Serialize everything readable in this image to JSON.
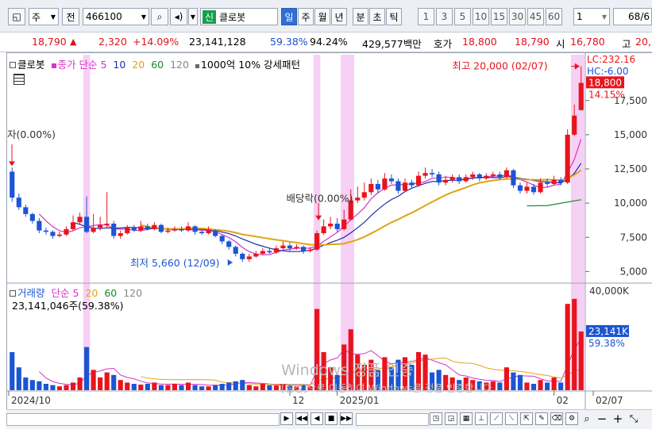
{
  "toolbar": {
    "type_label": "주",
    "jeon_label": "전",
    "code": "466100",
    "sin_badge": "신",
    "stock_name": "클로봇",
    "periods": [
      "일",
      "주",
      "월",
      "년",
      "분",
      "초",
      "틱"
    ],
    "selected_period": "일",
    "intervals": [
      "1",
      "3",
      "5",
      "10",
      "15",
      "30",
      "45",
      "60"
    ],
    "count_value": "1",
    "page_value": "68/6"
  },
  "quote": {
    "price": "18,790",
    "arrow": "▲",
    "change": "2,320",
    "change_pct": "+14.09%",
    "volume": "23,141,128",
    "turnover_pct": "59.38%",
    "strength_pct": "94.24%",
    "amount": "429,577백만",
    "ask_label": "호가",
    "ask_price": "18,800",
    "bid_price": "18,790",
    "open_label": "시",
    "open_price": "16,780",
    "high_label": "고",
    "high_price": "20,"
  },
  "price_legend": {
    "name": "클로봇",
    "ma_label": "종가 단순",
    "ma_periods": [
      "5",
      "10",
      "20",
      "60",
      "120"
    ],
    "pattern": "1000억 10% 강세패턴"
  },
  "volume_legend": {
    "name": "거래량",
    "ma_label": "단순",
    "ma_periods": [
      "5",
      "20",
      "60",
      "120"
    ],
    "volume_text": "23,141,046주(59.38%)"
  },
  "annotations": {
    "high": "최고 20,000 (02/07)",
    "low": "최저 5,660 (12/09)",
    "dividend": "배당락(0.00%)",
    "left_marker": "자(0.00%)"
  },
  "right_axis": {
    "lc": "LC:232.16",
    "hc": "HC:-6.00",
    "current_price": "18,800",
    "current_pct": "14.15%",
    "price_ticks": [
      "17,500",
      "15,000",
      "12,500",
      "10,000",
      "7,500",
      "5,000"
    ],
    "volume_top": "40,000K",
    "volume_current": "23,141K",
    "volume_pct": "59.38%"
  },
  "x_labels": [
    "2024/10",
    "12",
    "2025/01",
    "02",
    "02/07"
  ],
  "watermark": {
    "line1": "Windows 정품 인증",
    "line2": "[설정]으로 이동하여 Windows를 정품 인증합니다."
  },
  "colors": {
    "up": "#e8141d",
    "down": "#1c55d4",
    "ma5": "#d633c8",
    "ma10": "#1a2fa8",
    "ma20": "#e0a418",
    "ma60": "#138a2c",
    "highlight": "#f6c8f3"
  },
  "chart_data": {
    "type": "candlestick",
    "ylim": [
      4500,
      20500
    ],
    "volume_ylim": [
      0,
      40000000
    ],
    "candles": [
      {
        "o": 12300,
        "c": 10400,
        "h": 12600,
        "l": 10100,
        "v": 15000000
      },
      {
        "o": 10400,
        "c": 9700,
        "h": 10700,
        "l": 9500,
        "v": 9000000
      },
      {
        "o": 9700,
        "c": 9200,
        "h": 9900,
        "l": 9000,
        "v": 5000000
      },
      {
        "o": 9200,
        "c": 8700,
        "h": 9300,
        "l": 8500,
        "v": 4000000
      },
      {
        "o": 8700,
        "c": 8000,
        "h": 8900,
        "l": 7800,
        "v": 3500000
      },
      {
        "o": 8000,
        "c": 7900,
        "h": 8200,
        "l": 7700,
        "v": 2500000
      },
      {
        "o": 7900,
        "c": 7600,
        "h": 8000,
        "l": 7400,
        "v": 2000000
      },
      {
        "o": 7600,
        "c": 7700,
        "h": 7900,
        "l": 7500,
        "v": 1500000
      },
      {
        "o": 7700,
        "c": 8100,
        "h": 8300,
        "l": 7600,
        "v": 2000000
      },
      {
        "o": 8100,
        "c": 8600,
        "h": 9100,
        "l": 8000,
        "v": 3000000
      },
      {
        "o": 8600,
        "c": 9000,
        "h": 9300,
        "l": 8400,
        "v": 5000000
      },
      {
        "o": 9000,
        "c": 7900,
        "h": 10500,
        "l": 7800,
        "v": 17000000
      },
      {
        "o": 7900,
        "c": 8200,
        "h": 9200,
        "l": 7800,
        "v": 8000000
      },
      {
        "o": 8200,
        "c": 8400,
        "h": 9000,
        "l": 8000,
        "v": 5000000
      },
      {
        "o": 8400,
        "c": 8500,
        "h": 10800,
        "l": 8200,
        "v": 7000000
      },
      {
        "o": 8500,
        "c": 7600,
        "h": 8700,
        "l": 7400,
        "v": 6000000
      },
      {
        "o": 7600,
        "c": 7800,
        "h": 8000,
        "l": 7400,
        "v": 4000000
      },
      {
        "o": 7800,
        "c": 8200,
        "h": 8400,
        "l": 7700,
        "v": 3000000
      },
      {
        "o": 8200,
        "c": 8000,
        "h": 8400,
        "l": 7900,
        "v": 2500000
      },
      {
        "o": 8000,
        "c": 8300,
        "h": 8700,
        "l": 7900,
        "v": 2200000
      },
      {
        "o": 8300,
        "c": 8100,
        "h": 8500,
        "l": 8000,
        "v": 2500000
      },
      {
        "o": 8100,
        "c": 8400,
        "h": 8600,
        "l": 8000,
        "v": 3000000
      },
      {
        "o": 8400,
        "c": 7900,
        "h": 8500,
        "l": 7800,
        "v": 2000000
      },
      {
        "o": 7900,
        "c": 8000,
        "h": 8200,
        "l": 7800,
        "v": 2000000
      },
      {
        "o": 8000,
        "c": 8100,
        "h": 8300,
        "l": 7900,
        "v": 2500000
      },
      {
        "o": 8100,
        "c": 8000,
        "h": 8300,
        "l": 7900,
        "v": 2000000
      },
      {
        "o": 8000,
        "c": 8300,
        "h": 8600,
        "l": 7900,
        "v": 3000000
      },
      {
        "o": 8300,
        "c": 7900,
        "h": 8400,
        "l": 7700,
        "v": 2000000
      },
      {
        "o": 7900,
        "c": 7800,
        "h": 8100,
        "l": 7700,
        "v": 1500000
      },
      {
        "o": 7800,
        "c": 8000,
        "h": 8300,
        "l": 7700,
        "v": 1500000
      },
      {
        "o": 8000,
        "c": 7600,
        "h": 8100,
        "l": 7500,
        "v": 2000000
      },
      {
        "o": 7600,
        "c": 7200,
        "h": 7700,
        "l": 7000,
        "v": 2500000
      },
      {
        "o": 7200,
        "c": 6800,
        "h": 7300,
        "l": 6600,
        "v": 3000000
      },
      {
        "o": 6800,
        "c": 6300,
        "h": 6900,
        "l": 6100,
        "v": 3500000
      },
      {
        "o": 6300,
        "c": 5900,
        "h": 6400,
        "l": 5700,
        "v": 4000000
      },
      {
        "o": 5900,
        "c": 6100,
        "h": 6300,
        "l": 5700,
        "v": 2000000
      },
      {
        "o": 6100,
        "c": 6300,
        "h": 6500,
        "l": 6000,
        "v": 1500000
      },
      {
        "o": 6300,
        "c": 6500,
        "h": 6700,
        "l": 6200,
        "v": 2500000
      },
      {
        "o": 6500,
        "c": 6400,
        "h": 6700,
        "l": 6300,
        "v": 2000000
      },
      {
        "o": 6400,
        "c": 6700,
        "h": 6900,
        "l": 6300,
        "v": 1800000
      },
      {
        "o": 6700,
        "c": 6900,
        "h": 7200,
        "l": 6600,
        "v": 2500000
      },
      {
        "o": 6900,
        "c": 6700,
        "h": 7100,
        "l": 6500,
        "v": 2000000
      },
      {
        "o": 6700,
        "c": 6800,
        "h": 7000,
        "l": 6600,
        "v": 1500000
      },
      {
        "o": 6800,
        "c": 6500,
        "h": 6900,
        "l": 6300,
        "v": 2000000
      },
      {
        "o": 6500,
        "c": 6600,
        "h": 6800,
        "l": 6400,
        "v": 1500000
      },
      {
        "o": 6600,
        "c": 7800,
        "h": 8000,
        "l": 6500,
        "v": 32000000
      },
      {
        "o": 7800,
        "c": 8300,
        "h": 8800,
        "l": 7700,
        "v": 15000000
      },
      {
        "o": 8300,
        "c": 8500,
        "h": 9000,
        "l": 8100,
        "v": 9000000
      },
      {
        "o": 8500,
        "c": 8100,
        "h": 8900,
        "l": 7900,
        "v": 6000000
      },
      {
        "o": 8100,
        "c": 8800,
        "h": 9500,
        "l": 8000,
        "v": 18000000
      },
      {
        "o": 8800,
        "c": 10200,
        "h": 11000,
        "l": 8700,
        "v": 24000000
      },
      {
        "o": 10200,
        "c": 10400,
        "h": 11200,
        "l": 10000,
        "v": 14000000
      },
      {
        "o": 10400,
        "c": 10800,
        "h": 11500,
        "l": 10200,
        "v": 10000000
      },
      {
        "o": 10800,
        "c": 11400,
        "h": 11800,
        "l": 10600,
        "v": 12000000
      },
      {
        "o": 11400,
        "c": 11000,
        "h": 11700,
        "l": 10700,
        "v": 8000000
      },
      {
        "o": 11000,
        "c": 11800,
        "h": 12200,
        "l": 10900,
        "v": 13000000
      },
      {
        "o": 11800,
        "c": 11600,
        "h": 12100,
        "l": 11400,
        "v": 9000000
      },
      {
        "o": 11600,
        "c": 10900,
        "h": 11800,
        "l": 10700,
        "v": 12000000
      },
      {
        "o": 10900,
        "c": 11500,
        "h": 11800,
        "l": 10800,
        "v": 13000000
      },
      {
        "o": 11500,
        "c": 11300,
        "h": 11700,
        "l": 11100,
        "v": 10000000
      },
      {
        "o": 11300,
        "c": 12000,
        "h": 12300,
        "l": 11200,
        "v": 15000000
      },
      {
        "o": 12000,
        "c": 12200,
        "h": 12600,
        "l": 11800,
        "v": 14000000
      },
      {
        "o": 12200,
        "c": 12100,
        "h": 12500,
        "l": 11900,
        "v": 7000000
      },
      {
        "o": 12100,
        "c": 11500,
        "h": 12300,
        "l": 11300,
        "v": 8000000
      },
      {
        "o": 11500,
        "c": 11700,
        "h": 12000,
        "l": 11300,
        "v": 6000000
      },
      {
        "o": 11700,
        "c": 11900,
        "h": 12100,
        "l": 11500,
        "v": 5000000
      },
      {
        "o": 11900,
        "c": 11600,
        "h": 12100,
        "l": 11400,
        "v": 4000000
      },
      {
        "o": 11600,
        "c": 11900,
        "h": 12100,
        "l": 11500,
        "v": 5000000
      },
      {
        "o": 11900,
        "c": 12100,
        "h": 12300,
        "l": 11700,
        "v": 4000000
      },
      {
        "o": 12100,
        "c": 11800,
        "h": 12200,
        "l": 11600,
        "v": 3500000
      },
      {
        "o": 11800,
        "c": 12000,
        "h": 12200,
        "l": 11700,
        "v": 3000000
      },
      {
        "o": 12000,
        "c": 12100,
        "h": 12300,
        "l": 11800,
        "v": 3500000
      },
      {
        "o": 12100,
        "c": 11900,
        "h": 12300,
        "l": 11700,
        "v": 3000000
      },
      {
        "o": 11900,
        "c": 12400,
        "h": 12600,
        "l": 11800,
        "v": 9000000
      },
      {
        "o": 12400,
        "c": 11300,
        "h": 12500,
        "l": 11100,
        "v": 7000000
      },
      {
        "o": 11300,
        "c": 10900,
        "h": 11500,
        "l": 10700,
        "v": 6000000
      },
      {
        "o": 10900,
        "c": 11200,
        "h": 11500,
        "l": 10700,
        "v": 3000000
      },
      {
        "o": 11200,
        "c": 10800,
        "h": 11400,
        "l": 10600,
        "v": 2500000
      },
      {
        "o": 10800,
        "c": 11500,
        "h": 11800,
        "l": 10700,
        "v": 4000000
      },
      {
        "o": 11500,
        "c": 11400,
        "h": 11800,
        "l": 11200,
        "v": 3000000
      },
      {
        "o": 11400,
        "c": 11700,
        "h": 12000,
        "l": 11300,
        "v": 5000000
      },
      {
        "o": 11700,
        "c": 11500,
        "h": 11900,
        "l": 11300,
        "v": 3000000
      },
      {
        "o": 11500,
        "c": 15000,
        "h": 15400,
        "l": 11400,
        "v": 34000000
      },
      {
        "o": 15000,
        "c": 16400,
        "h": 17200,
        "l": 14900,
        "v": 36000000
      },
      {
        "o": 16800,
        "c": 18790,
        "h": 20000,
        "l": 16780,
        "v": 23141046
      }
    ]
  }
}
